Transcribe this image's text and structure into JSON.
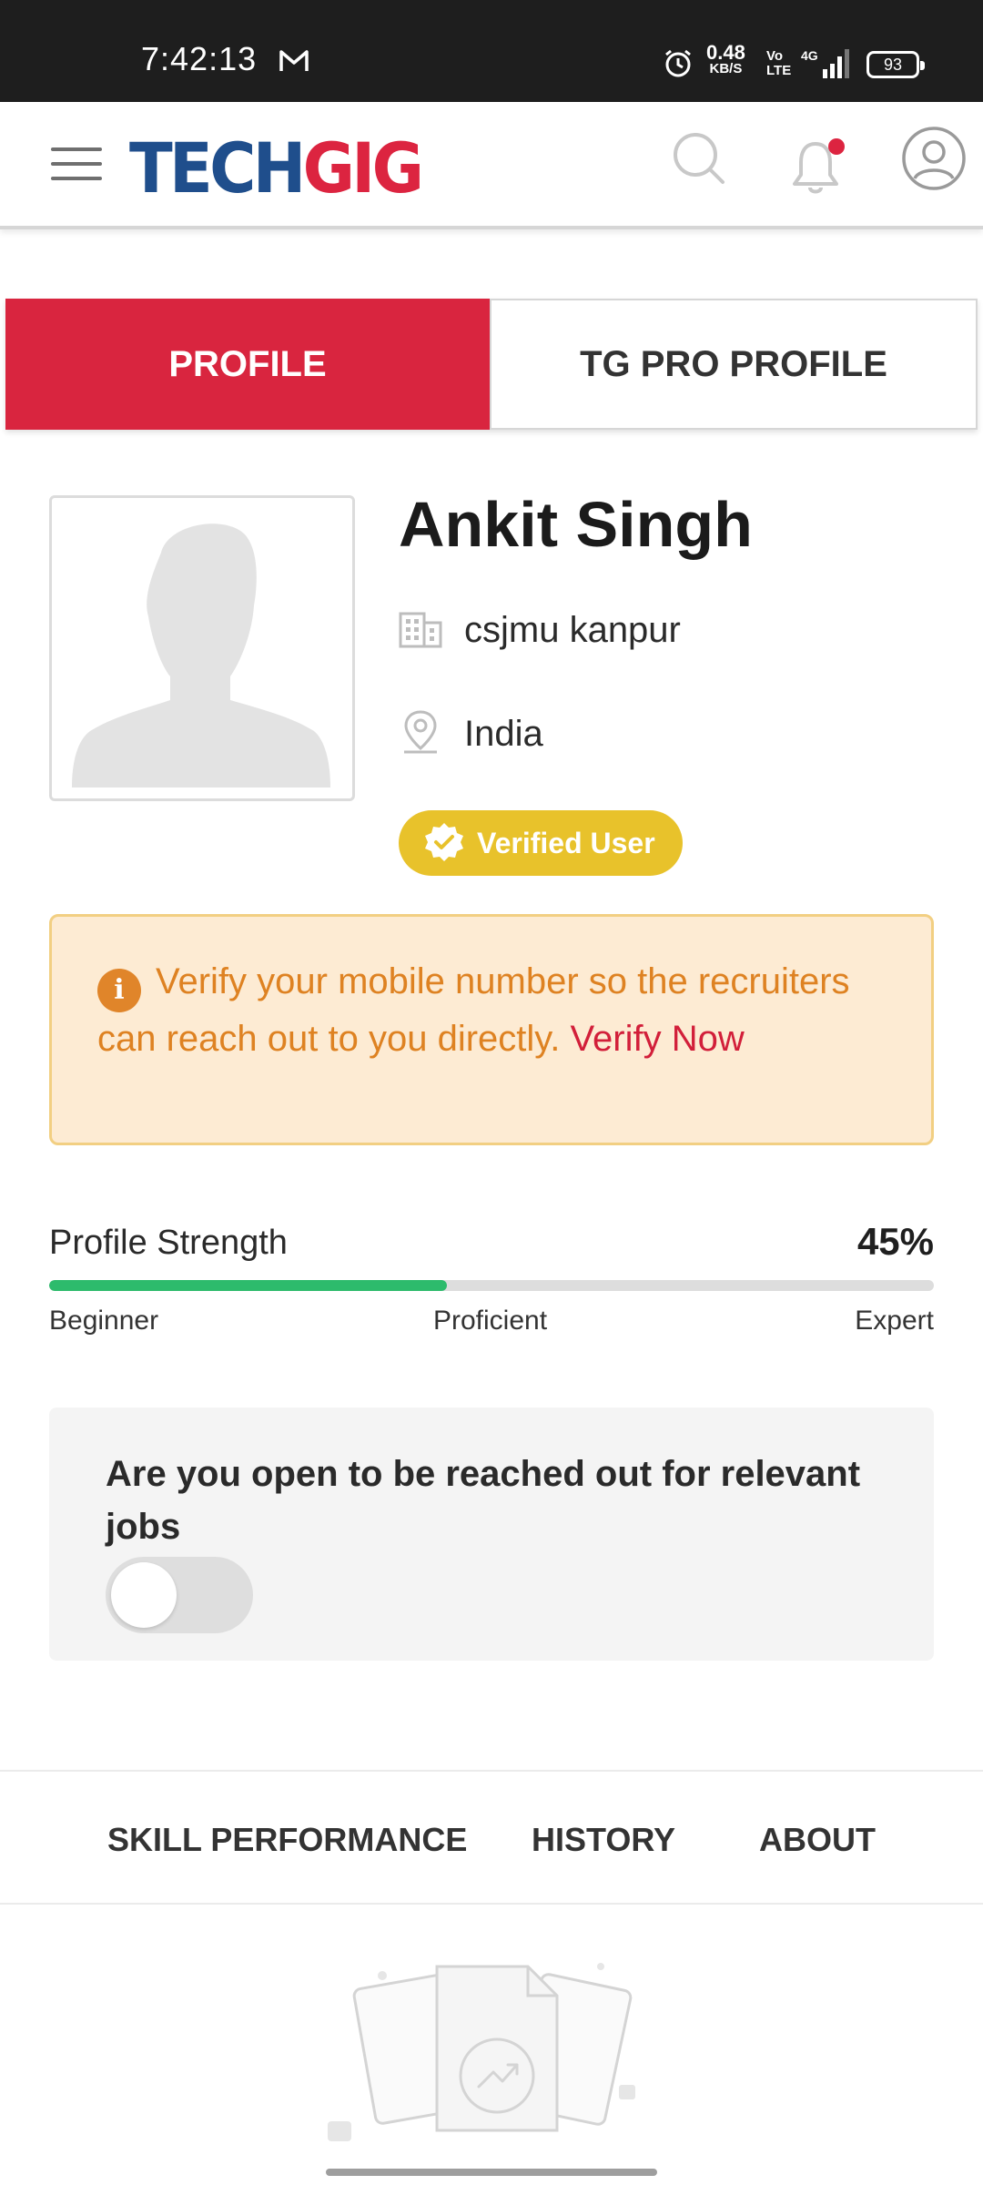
{
  "status_bar": {
    "time": "7:42:13",
    "speed_value": "0.48",
    "speed_unit": "KB/S",
    "volte_top": "Vo",
    "volte_bottom": "LTE",
    "network": "4G",
    "battery": "93"
  },
  "header": {
    "logo_part1": "TECH",
    "logo_part2": "GIG",
    "logo_color_1": "#1f4e8c",
    "logo_color_2": "#dc2440"
  },
  "tabs": [
    {
      "label": "PROFILE",
      "active": true
    },
    {
      "label": "TG PRO PROFILE",
      "active": false
    }
  ],
  "profile": {
    "name": "Ankit Singh",
    "organization": "csjmu kanpur",
    "location": "India",
    "verified_label": "Verified User"
  },
  "alert": {
    "info_glyph": "i",
    "message": "Verify your mobile number so the recruiters can reach out to you directly.",
    "link": "Verify Now"
  },
  "strength": {
    "label": "Profile Strength",
    "value_text": "45%",
    "value": 45,
    "levels": [
      "Beginner",
      "Proficient",
      "Expert"
    ]
  },
  "open_to_jobs": {
    "question": "Are you open to be reached out for relevant jobs",
    "enabled": false
  },
  "bottom_tabs": [
    "SKILL PERFORMANCE",
    "HISTORY",
    "ABOUT"
  ],
  "colors": {
    "primary_red": "#d9253f",
    "verified_yellow": "#e8c22b",
    "progress_green": "#2dbb6c",
    "alert_orange": "#de8222"
  }
}
